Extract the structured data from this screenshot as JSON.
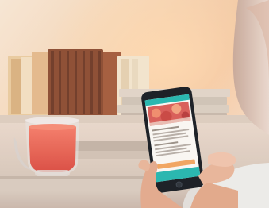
{
  "scene": {
    "subjects": [
      "book-stack",
      "tea-cup",
      "smartphone",
      "hand",
      "person"
    ],
    "colors": {
      "wall": "#f1dcc4",
      "wall_warm": "#f4c49a",
      "table": "#e4d5c7",
      "book_red": "#a04b2e",
      "book_brown": "#7f4a31",
      "book_cream": "#f0e2c8",
      "tea": "#ef6152",
      "phone_body": "#151a20",
      "screen_accent": "#23b5ad",
      "screen_image": "#d85a55",
      "button_orange": "#f1a35d",
      "skin": "#e8b397",
      "sweater": "#ecebe8"
    }
  }
}
